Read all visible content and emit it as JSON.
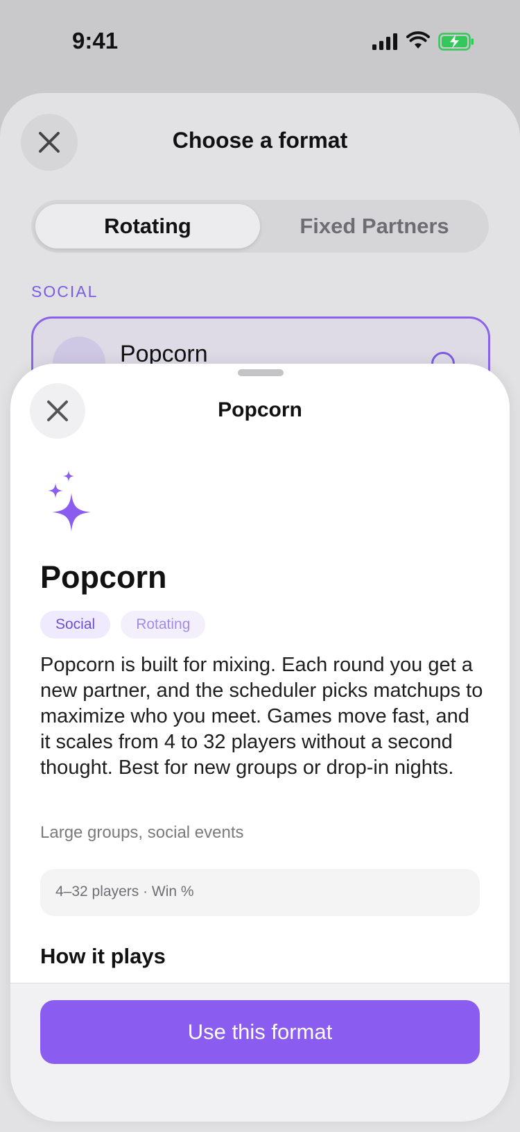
{
  "status_bar": {
    "time": "9:41",
    "icons": [
      "cellular-signal-icon",
      "wifi-icon",
      "battery-charging-icon"
    ],
    "battery_color": "#34c759"
  },
  "background_sheet": {
    "title": "Choose a format",
    "close_icon": "close-icon",
    "segmented_control": {
      "options": [
        "Rotating",
        "Fixed Partners"
      ],
      "selected": "Rotating"
    },
    "section_label": "SOCIAL",
    "selected_card": {
      "title": "Popcorn",
      "icon": "sparkle-icon",
      "info_icon": "info-icon"
    }
  },
  "detail_sheet": {
    "title": "Popcorn",
    "close_icon": "close-icon",
    "hero_icon": "sparkle-icon",
    "format_name": "Popcorn",
    "tags": [
      "Social",
      "Rotating"
    ],
    "description": "Popcorn is built for mixing. Each round you get a new partner, and the scheduler picks matchups to maximize who you meet. Games move fast, and it scales from 4 to 32 players without a second thought. Best for new groups or drop-in nights.",
    "best_for": "Large groups, social events",
    "meta": "4–32 players · Win %",
    "how_it_plays_heading": "How it plays",
    "primary_button": "Use this format"
  },
  "colors": {
    "accent": "#8a5cf0",
    "accent_text": "#7b5be2",
    "tag_social_bg": "#efeafd"
  }
}
